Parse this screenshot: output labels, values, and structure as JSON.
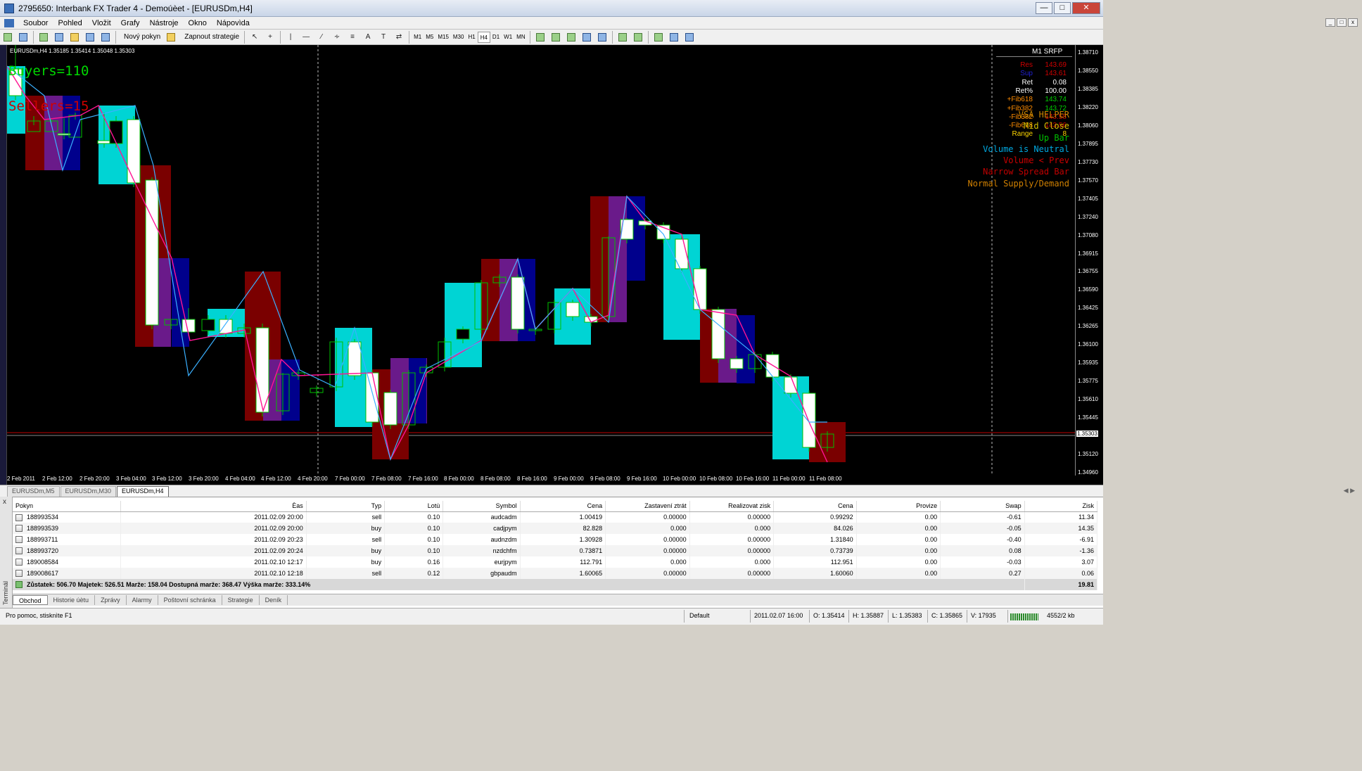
{
  "window": {
    "title": "2795650: Interbank FX Trader 4 - Demoúèet - [EURUSDm,H4]"
  },
  "menu": [
    "Soubor",
    "Pohled",
    "Vložit",
    "Grafy",
    "Nástroje",
    "Okno",
    "Nápovìda"
  ],
  "toolbar": {
    "new_order": "Nový pokyn",
    "strategies": "Zapnout strategie",
    "timeframes": [
      "M1",
      "M5",
      "M15",
      "M30",
      "H1",
      "H4",
      "D1",
      "W1",
      "MN"
    ]
  },
  "chart": {
    "symbol_info": "EURUSDm,H4  1.35185 1.35414 1.35048 1.35303",
    "buyers": "Buyers=110",
    "sellers": "Sellers=15",
    "price_axis": [
      "1.38710",
      "1.38550",
      "1.38385",
      "1.38220",
      "1.38060",
      "1.37895",
      "1.37730",
      "1.37570",
      "1.37405",
      "1.37240",
      "1.37080",
      "1.36915",
      "1.36755",
      "1.36590",
      "1.36425",
      "1.36265",
      "1.36100",
      "1.35935",
      "1.35775",
      "1.35610",
      "1.35445",
      "1.35303",
      "1.35120",
      "1.34960"
    ],
    "current_price": "1.35303",
    "time_axis": [
      "2 Feb 2011",
      "2 Feb 12:00",
      "2 Feb 20:00",
      "3 Feb 04:00",
      "3 Feb 12:00",
      "3 Feb 20:00",
      "4 Feb 04:00",
      "4 Feb 12:00",
      "4 Feb 20:00",
      "7 Feb 00:00",
      "7 Feb 08:00",
      "7 Feb 16:00",
      "8 Feb 00:00",
      "8 Feb 08:00",
      "8 Feb 16:00",
      "9 Feb 00:00",
      "9 Feb 08:00",
      "9 Feb 16:00",
      "10 Feb 00:00",
      "10 Feb 08:00",
      "10 Feb 16:00",
      "11 Feb 00:00",
      "11 Feb 08:00"
    ],
    "colors": {
      "background": "#000000",
      "cyan": "#00d4d4",
      "maroon": "#7a0000",
      "purple": "#6a1a8a",
      "navy": "#00008c",
      "green": "#00c000",
      "white": "#ffffff",
      "pink": "#ff1493",
      "blue": "#3ab0ff"
    },
    "srfp": {
      "header": "M1 SRFP",
      "rows": [
        {
          "k": "Res",
          "v": "143.69",
          "ck": "#d00000",
          "cv": "#d00000"
        },
        {
          "k": "Sup",
          "v": "143.61",
          "ck": "#2020d0",
          "cv": "#d00000"
        },
        {
          "k": "Ret",
          "v": "0.08",
          "ck": "#ffffff",
          "cv": "#ffffff"
        },
        {
          "k": "Ret%",
          "v": "100.00",
          "ck": "#ffffff",
          "cv": "#ffffff"
        },
        {
          "k": "+Fib618",
          "v": "143.74",
          "ck": "#ff8c00",
          "cv": "#00d000"
        },
        {
          "k": "+Fib382",
          "v": "143.72",
          "ck": "#ff8c00",
          "cv": "#00d000"
        },
        {
          "k": "-Fib382",
          "v": "143.58",
          "ck": "#ff8c00",
          "cv": "#d00000"
        },
        {
          "k": "-Fib618",
          "v": "143.56",
          "ck": "#ff8c00",
          "cv": "#d00000"
        },
        {
          "k": "Range",
          "v": "8",
          "ck": "#ffd700",
          "cv": "#ffd700"
        }
      ]
    },
    "vsa": [
      {
        "text": "VSA HELPER",
        "color": "#cc8800"
      },
      {
        "text": "Mid Close",
        "color": "#d4c000"
      },
      {
        "text": "Up Bar",
        "color": "#00c000"
      },
      {
        "text": "Volume is Neutral",
        "color": "#00a8e0"
      },
      {
        "text": "Volume < Prev",
        "color": "#d00000"
      },
      {
        "text": "Narrow Spread Bar",
        "color": "#c00000"
      },
      {
        "text": "Normal Supply/Demand",
        "color": "#d08000"
      }
    ]
  },
  "chart_tabs": [
    "EURUSDm,M5",
    "EURUSDm,M30",
    "EURUSDm,H4"
  ],
  "chart_tabs_active": 2,
  "orders": {
    "columns": [
      "Pokyn",
      "Èas",
      "Typ",
      "Lotù",
      "Symbol",
      "Cena",
      "Zastavení ztrát",
      "Realizovat zisk",
      "Cena",
      "Provize",
      "Swap",
      "Zisk"
    ],
    "rows": [
      [
        "188993534",
        "2011.02.09 20:00",
        "sell",
        "0.10",
        "audcadm",
        "1.00419",
        "0.00000",
        "0.00000",
        "0.99292",
        "0.00",
        "-0.61",
        "11.34"
      ],
      [
        "188993539",
        "2011.02.09 20:00",
        "buy",
        "0.10",
        "cadjpym",
        "82.828",
        "0.000",
        "0.000",
        "84.026",
        "0.00",
        "-0.05",
        "14.35"
      ],
      [
        "188993711",
        "2011.02.09 20:23",
        "sell",
        "0.10",
        "audnzdm",
        "1.30928",
        "0.00000",
        "0.00000",
        "1.31840",
        "0.00",
        "-0.40",
        "-6.91"
      ],
      [
        "188993720",
        "2011.02.09 20:24",
        "buy",
        "0.10",
        "nzdchfm",
        "0.73871",
        "0.00000",
        "0.00000",
        "0.73739",
        "0.00",
        "0.08",
        "-1.36"
      ],
      [
        "189008584",
        "2011.02.10 12:17",
        "buy",
        "0.16",
        "eurjpym",
        "112.791",
        "0.000",
        "0.000",
        "112.951",
        "0.00",
        "-0.03",
        "3.07"
      ],
      [
        "189008617",
        "2011.02.10 12:18",
        "sell",
        "0.12",
        "gbpaudm",
        "1.60065",
        "0.00000",
        "0.00000",
        "1.60060",
        "0.00",
        "0.27",
        "0.06"
      ]
    ],
    "summary": "Zůstatek: 506.70  Majetek: 526.51  Marže: 158.04  Dostupná marže: 368.47  Výška marže: 333.14%",
    "total": "19.81"
  },
  "terminal_label": "Terminál",
  "terminal_tabs": [
    "Obchod",
    "Historie úètu",
    "Zprávy",
    "Alarmy",
    "Poštovní schránka",
    "Strategie",
    "Deník"
  ],
  "status": {
    "help": "Pro pomoc, stisknìte F1",
    "profile": "Default",
    "time": "2011.02.07 16:00",
    "open": "O: 1.35414",
    "high": "H: 1.35887",
    "low": "L: 1.35383",
    "close": "C: 1.35865",
    "volume": "V: 17935",
    "traffic": "4552/2 kb"
  }
}
